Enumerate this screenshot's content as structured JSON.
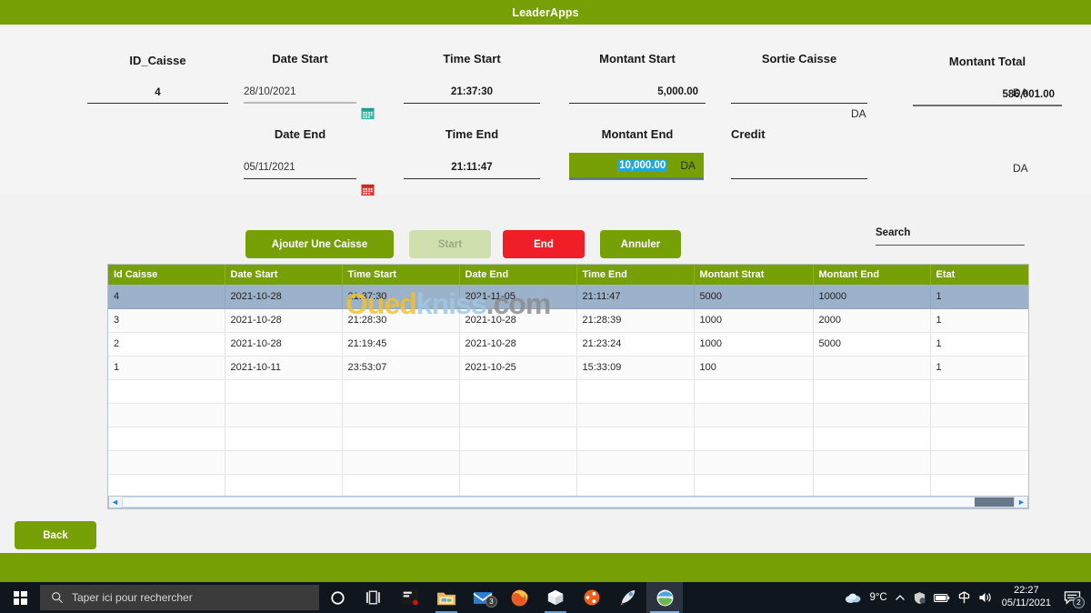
{
  "window": {
    "title": "LeaderApps"
  },
  "form": {
    "fields": [
      {
        "label": "ID_Caisse",
        "value": "4",
        "currency": ""
      },
      {
        "label": "Date Start",
        "value": "28/10/2021",
        "currency": ""
      },
      {
        "label": "Time Start",
        "value": "21:37:30",
        "currency": ""
      },
      {
        "label": "Montant Start",
        "value": "5,000.00",
        "currency": "DA"
      },
      {
        "label": "Sortie Caisse",
        "value": "",
        "currency": "DA"
      },
      {
        "label": "Montant Total",
        "value": "586,001.00",
        "currency": "DA"
      },
      {
        "label": "Date End",
        "value": "05/11/2021",
        "currency": ""
      },
      {
        "label": "Time End",
        "value": "21:11:47",
        "currency": ""
      },
      {
        "label": "Montant End",
        "value": "10,000.00",
        "currency": "DA"
      },
      {
        "label": "Credit",
        "value": "",
        "currency": "DA"
      }
    ]
  },
  "buttons": {
    "add": "Ajouter Une Caisse",
    "start": "Start",
    "end": "End",
    "cancel": "Annuler",
    "back": "Back"
  },
  "search": {
    "label": "Search",
    "value": "",
    "placeholder": ""
  },
  "table": {
    "columns": [
      "Id Caisse",
      "Date Start",
      "Time Start",
      "Date End",
      "Time End",
      "Montant Strat",
      "Montant End",
      "Etat"
    ],
    "rows": [
      [
        "4",
        "2021-10-28",
        "21:37:30",
        "2021-11-05",
        "21:11:47",
        "5000",
        "10000",
        "1"
      ],
      [
        "3",
        "2021-10-28",
        "21:28:30",
        "2021-10-28",
        "21:28:39",
        "1000",
        "2000",
        "1"
      ],
      [
        "2",
        "2021-10-28",
        "21:19:45",
        "2021-10-28",
        "21:23:24",
        "1000",
        "5000",
        "1"
      ],
      [
        "1",
        "2021-10-11",
        "23:53:07",
        "2021-10-25",
        "15:33:09",
        "100",
        "",
        "1"
      ],
      [
        "",
        "",
        "",
        "",
        "",
        "",
        "",
        ""
      ],
      [
        "",
        "",
        "",
        "",
        "",
        "",
        "",
        ""
      ],
      [
        "",
        "",
        "",
        "",
        "",
        "",
        "",
        ""
      ],
      [
        "",
        "",
        "",
        "",
        "",
        "",
        "",
        ""
      ],
      [
        "",
        "",
        "",
        "",
        "",
        "",
        "",
        ""
      ]
    ],
    "selected_row_index": 0
  },
  "watermark": {
    "part1": "Oued",
    "part2": "kniss",
    "part3": ".com"
  },
  "taskbar": {
    "search_placeholder": "Taper ici pour rechercher",
    "mail_badge": "3",
    "weather_temp": "9°C",
    "time": "22:27",
    "date": "05/11/2021",
    "notification_count": "2"
  },
  "colors": {
    "brand_green": "#76a006",
    "danger_red": "#f01e28",
    "disabled_green": "#cfdfae",
    "selection_blue": "#1fa8da",
    "row_selected": "#9bb2ca"
  }
}
